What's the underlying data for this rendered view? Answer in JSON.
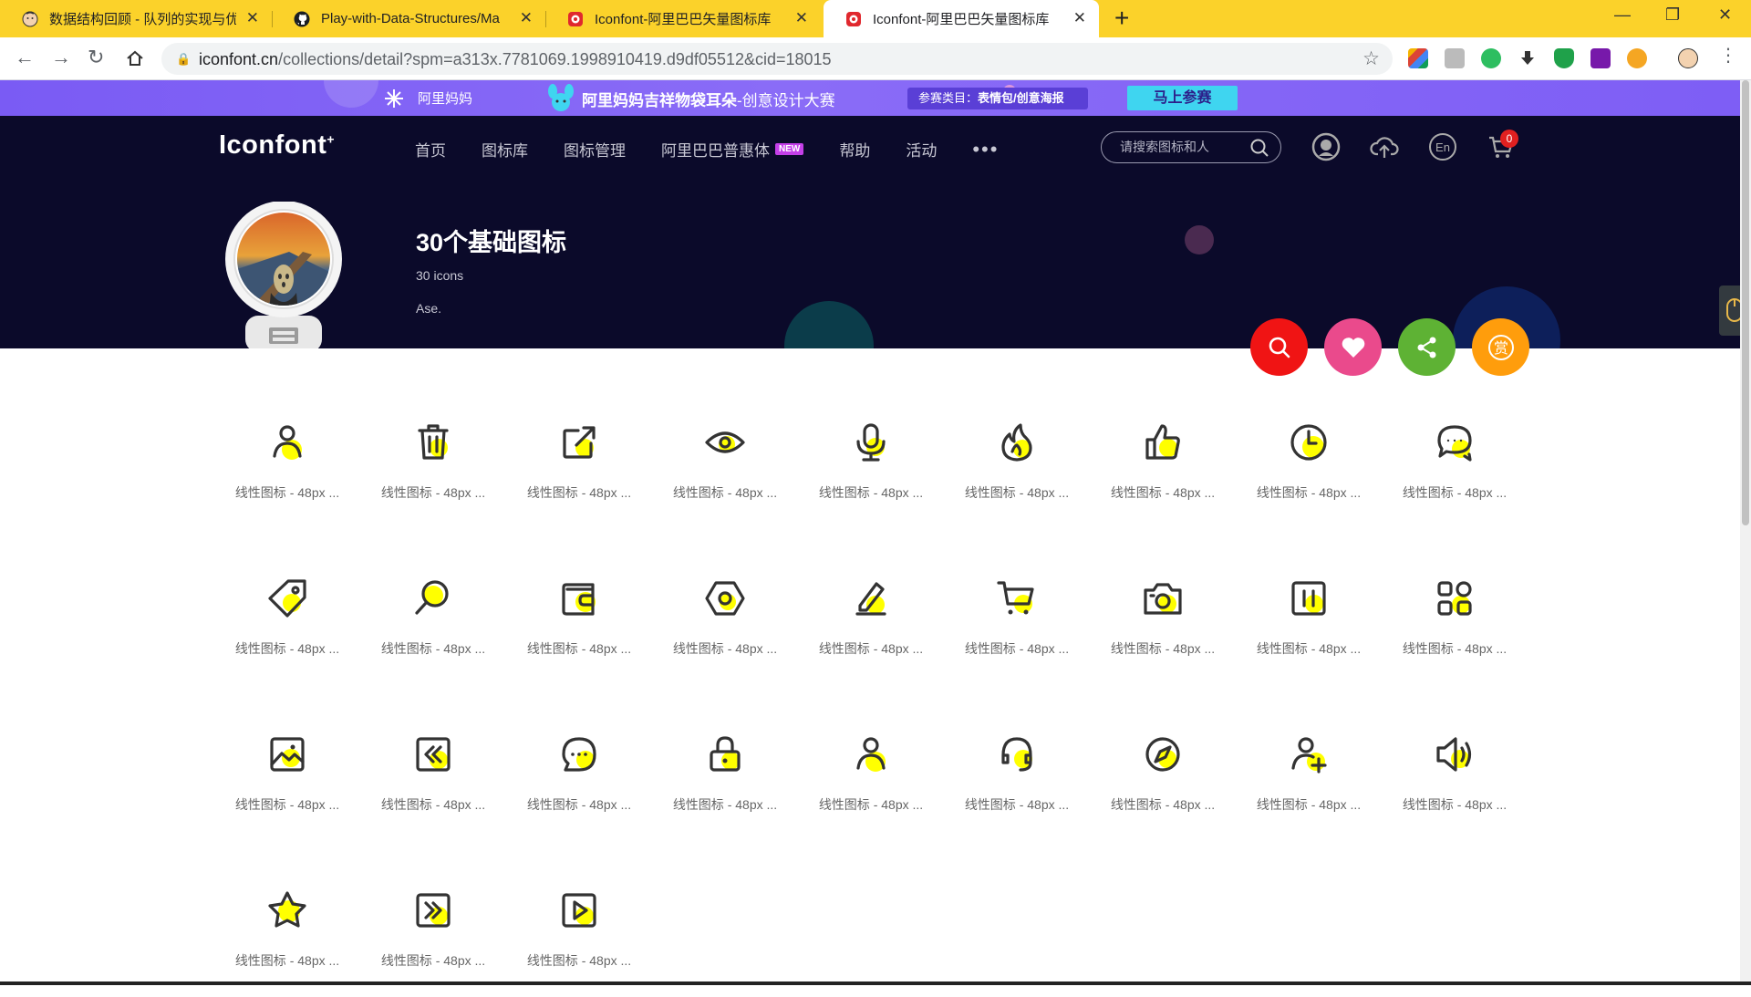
{
  "browser": {
    "tabs": [
      {
        "title": "数据结构回顾 - 队列的实现与优化",
        "favicon": "avatar-favicon"
      },
      {
        "title": "Play-with-Data-Structures/Ma",
        "favicon": "github-favicon"
      },
      {
        "title": "Iconfont-阿里巴巴矢量图标库",
        "favicon": "iconfont-favicon"
      },
      {
        "title": "Iconfont-阿里巴巴矢量图标库",
        "favicon": "iconfont-favicon",
        "active": true
      }
    ],
    "new_tab": "+",
    "url_domain": "iconfont.cn",
    "url_path": "/collections/detail?spm=a313x.7781069.1998910419.d9df05512&cid=18015",
    "accent": "#fbd22a"
  },
  "promo": {
    "brand": "阿里妈妈",
    "title_bold": "阿里妈妈吉祥物袋耳朵",
    "title_rest": "-创意设计大赛",
    "category_label": "参赛类目：",
    "category_value": "表情包/创意海报",
    "cta": "马上参赛"
  },
  "site": {
    "logo": "Iconfont",
    "logo_sup": "+",
    "nav": [
      "首页",
      "图标库",
      "图标管理",
      "阿里巴巴普惠体",
      "帮助",
      "活动"
    ],
    "nav_new_badge": "NEW",
    "nav_more": "•••",
    "search_placeholder": "请搜索图标和人",
    "cart_count": "0",
    "lang": "En"
  },
  "collection": {
    "title": "30个基础图标",
    "count": "30 icons",
    "author": "Ase."
  },
  "actions": [
    {
      "name": "search-action-button",
      "icon": "search-icon",
      "color": "#f01414"
    },
    {
      "name": "favorite-action-button",
      "icon": "heart-icon",
      "color": "#ea4a8c"
    },
    {
      "name": "share-action-button",
      "icon": "share-icon",
      "color": "#5eb234"
    },
    {
      "name": "reward-action-button",
      "icon": "reward-icon",
      "color": "#ff9d0c",
      "text": "赏"
    }
  ],
  "icons": [
    {
      "icon": "user-icon",
      "label": "线性图标 - 48px ..."
    },
    {
      "icon": "trash-icon",
      "label": "线性图标 - 48px ..."
    },
    {
      "icon": "edit-external-icon",
      "label": "线性图标 - 48px ..."
    },
    {
      "icon": "eye-icon",
      "label": "线性图标 - 48px ..."
    },
    {
      "icon": "microphone-icon",
      "label": "线性图标 - 48px ..."
    },
    {
      "icon": "fire-icon",
      "label": "线性图标 - 48px ..."
    },
    {
      "icon": "thumbs-up-icon",
      "label": "线性图标 - 48px ..."
    },
    {
      "icon": "clock-icon",
      "label": "线性图标 - 48px ..."
    },
    {
      "icon": "chat-bubbles-icon",
      "label": "线性图标 - 48px ..."
    },
    {
      "icon": "tag-icon",
      "label": "线性图标 - 48px ..."
    },
    {
      "icon": "search-icon",
      "label": "线性图标 - 48px ..."
    },
    {
      "icon": "wallet-icon",
      "label": "线性图标 - 48px ..."
    },
    {
      "icon": "settings-hexagon-icon",
      "label": "线性图标 - 48px ..."
    },
    {
      "icon": "pencil-icon",
      "label": "线性图标 - 48px ..."
    },
    {
      "icon": "cart-icon",
      "label": "线性图标 - 48px ..."
    },
    {
      "icon": "camera-icon",
      "label": "线性图标 - 48px ..."
    },
    {
      "icon": "pause-icon",
      "label": "线性图标 - 48px ..."
    },
    {
      "icon": "grid-apps-icon",
      "label": "线性图标 - 48px ..."
    },
    {
      "icon": "image-icon",
      "label": "线性图标 - 48px ..."
    },
    {
      "icon": "rewind-icon",
      "label": "线性图标 - 48px ..."
    },
    {
      "icon": "message-dots-icon",
      "label": "线性图标 - 48px ..."
    },
    {
      "icon": "lock-icon",
      "label": "线性图标 - 48px ..."
    },
    {
      "icon": "user-icon",
      "label": "线性图标 - 48px ..."
    },
    {
      "icon": "headset-icon",
      "label": "线性图标 - 48px ..."
    },
    {
      "icon": "compass-icon",
      "label": "线性图标 - 48px ..."
    },
    {
      "icon": "add-user-icon",
      "label": "线性图标 - 48px ..."
    },
    {
      "icon": "volume-icon",
      "label": "线性图标 - 48px ..."
    },
    {
      "icon": "star-icon",
      "label": "线性图标 - 48px ..."
    },
    {
      "icon": "fast-forward-icon",
      "label": "线性图标 - 48px ..."
    },
    {
      "icon": "play-icon",
      "label": "线性图标 - 48px ..."
    }
  ],
  "icon_colors": {
    "stroke": "#333333",
    "fill": "#ffff00"
  }
}
